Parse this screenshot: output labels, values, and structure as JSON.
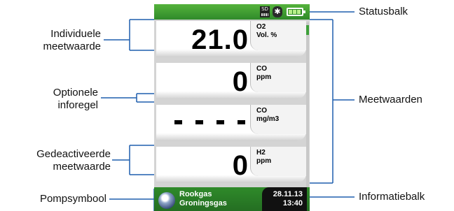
{
  "device": {
    "status": {
      "sd_label": "SD",
      "bt_glyph": "✱",
      "battery_level": 1.0
    },
    "readings": [
      {
        "value": "21.0",
        "param": "O2",
        "unit": "Vol. %",
        "active": true
      },
      {
        "value": "0",
        "param": "CO",
        "unit": "ppm",
        "active": true
      },
      {
        "value": "",
        "param": "CO",
        "unit": "mg/m3",
        "active": false
      },
      {
        "value": "0",
        "param": "H2",
        "unit": "ppm",
        "active": true
      }
    ],
    "info": {
      "fuel_line1": "Rookgas",
      "fuel_line2": "Groningsgas",
      "date": "28.11.13",
      "time": "13:40"
    }
  },
  "annotations": {
    "individuele": "Individuele\nmeetwaarde",
    "optionele": "Optionele\ninforegel",
    "gedeactiveerde": "Gedeactiveerde\nmeetwaarde",
    "pompsymbool": "Pompsymbool",
    "statusbalk": "Statusbalk",
    "meetwaarden": "Meetwaarden",
    "informatiebalk": "Informatiebalk"
  },
  "colors": {
    "accent_green": "#3ea03a",
    "screen_bg": "#d4d4d4"
  }
}
